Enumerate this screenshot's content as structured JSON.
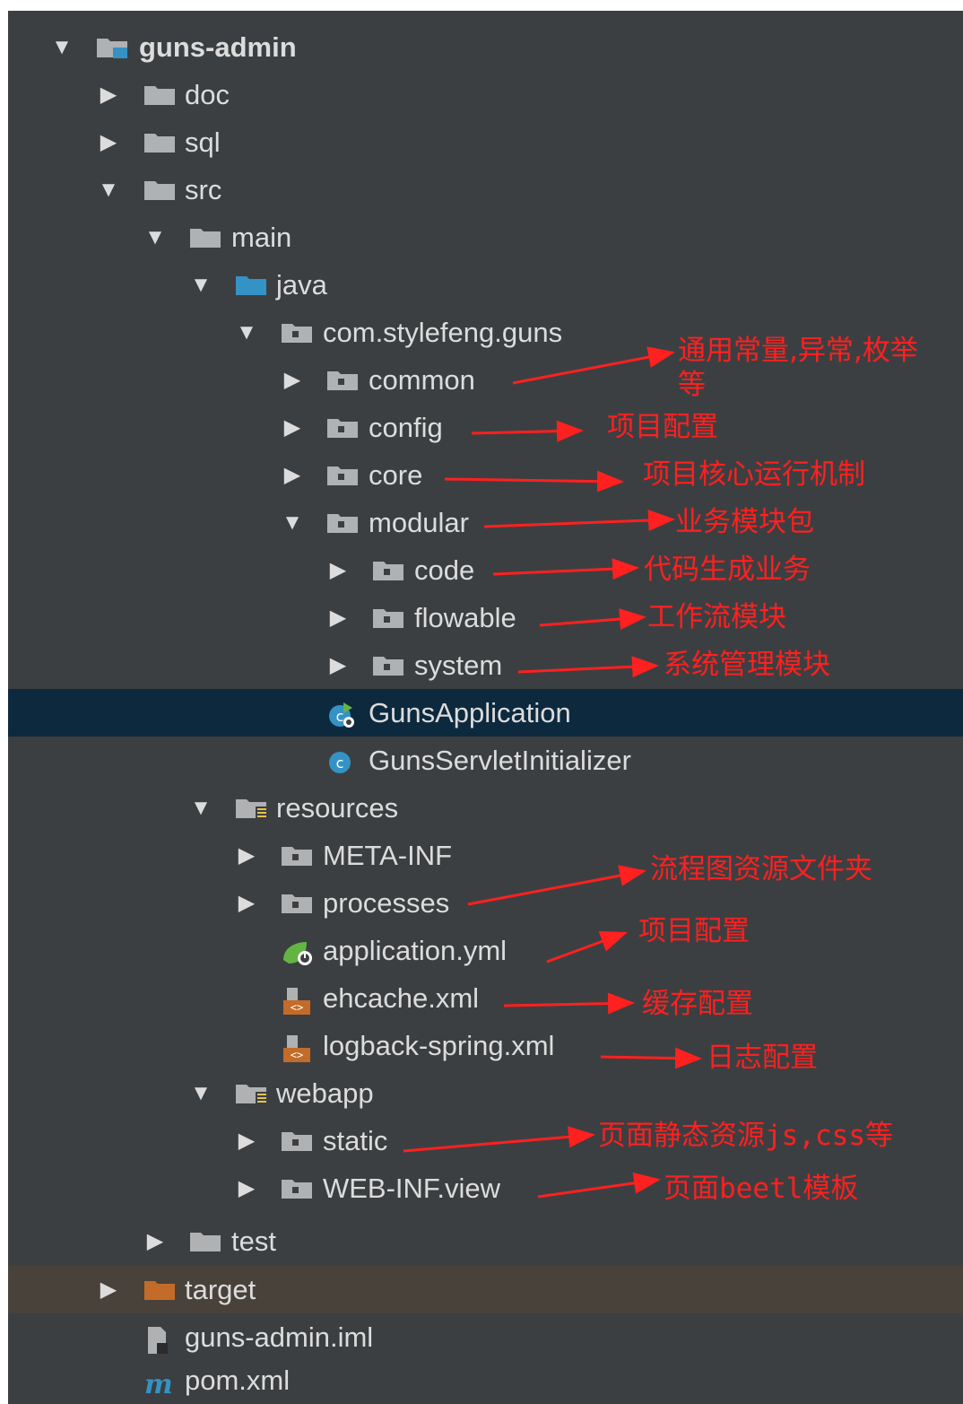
{
  "tree": {
    "root": "guns-admin",
    "doc": "doc",
    "sql": "sql",
    "src": "src",
    "main": "main",
    "java": "java",
    "package": "com.stylefeng.guns",
    "common": "common",
    "config": "config",
    "core": "core",
    "modular": "modular",
    "code": "code",
    "flowable": "flowable",
    "system": "system",
    "guns_application": "GunsApplication",
    "servlet_initializer": "GunsServletInitializer",
    "resources": "resources",
    "meta_inf": "META-INF",
    "processes": "processes",
    "application_yml": "application.yml",
    "ehcache_xml": "ehcache.xml",
    "logback_xml": "logback-spring.xml",
    "webapp": "webapp",
    "static": "static",
    "web_inf_view": "WEB-INF.view",
    "test": "test",
    "target": "target",
    "iml": "guns-admin.iml",
    "pom": "pom.xml"
  },
  "annotations": {
    "common_line1": "通用常量,异常,枚举",
    "common_line2": "等",
    "config": "项目配置",
    "core": "项目核心运行机制",
    "modular": "业务模块包",
    "code": "代码生成业务",
    "flowable": "工作流模块",
    "system": "系统管理模块",
    "processes": "流程图资源文件夹",
    "application_yml": "项目配置",
    "ehcache": "缓存配置",
    "logback": "日志配置",
    "static": "页面静态资源js,css等",
    "web_inf": "页面beetl模板"
  },
  "colors": {
    "panel": "#3c3f41",
    "text": "#dcdcdc",
    "selected_row": "#0d293e",
    "excluded_row": "#49423b",
    "folder": "#afb1b3",
    "source_folder": "#3592c4",
    "excluded_folder": "#c36b28",
    "annotation": "#ff2020"
  },
  "icons": {
    "expanded": "▼",
    "collapsed": "▶"
  }
}
